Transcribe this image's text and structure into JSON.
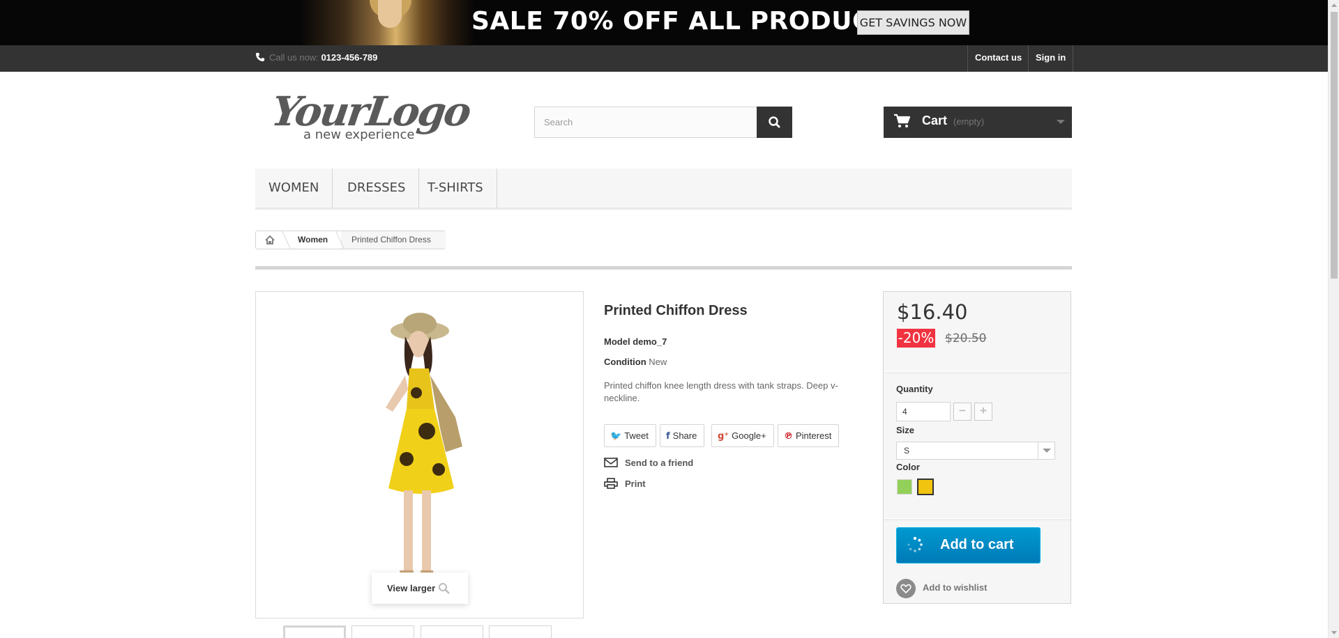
{
  "banner": {
    "text": "SALE 70% OFF ALL PRODUCTS",
    "button_label": "GET SAVINGS NOW"
  },
  "topnav": {
    "call_label": "Call us now:",
    "phone": "0123-456-789",
    "contact_label": "Contact us",
    "signin_label": "Sign in",
    "phone_icon": "phone-icon"
  },
  "header": {
    "logo_text": "YourLogo",
    "logo_tagline": "a new experience",
    "search_placeholder": "Search",
    "search_icon": "search-icon",
    "cart_label": "Cart",
    "cart_status": "(empty)"
  },
  "menu": {
    "items": [
      "WOMEN",
      "DRESSES",
      "T-SHIRTS"
    ]
  },
  "breadcrumb": {
    "home_icon": "home-icon",
    "items": [
      "Women",
      "Printed Chiffon Dress"
    ]
  },
  "product": {
    "title": "Printed Chiffon Dress",
    "model_label": "Model",
    "model_value": "demo_7",
    "condition_label": "Condition",
    "condition_value": "New",
    "description": "Printed chiffon knee length dress with tank straps. Deep v-neckline.",
    "view_larger": "View larger",
    "thumbnail_count": 4,
    "social": [
      "Tweet",
      "Share",
      "Google+",
      "Pinterest"
    ],
    "actions": [
      "Send to a friend",
      "Print"
    ]
  },
  "buybox": {
    "price": "$16.40",
    "discount": "-20%",
    "old_price": "$20.50",
    "quantity_label": "Quantity",
    "quantity_value": "4",
    "minus": "−",
    "plus": "+",
    "size_label": "Size",
    "size_value": "S",
    "color_label": "Color",
    "colors": [
      "#93d05a",
      "#f1c40f"
    ],
    "add_to_cart": "Add to cart",
    "wishlist": "Add to wishlist"
  },
  "colors": {
    "accent_blue": "#0189c5",
    "dark_bar": "#333333",
    "sale_red": "#f13340"
  }
}
